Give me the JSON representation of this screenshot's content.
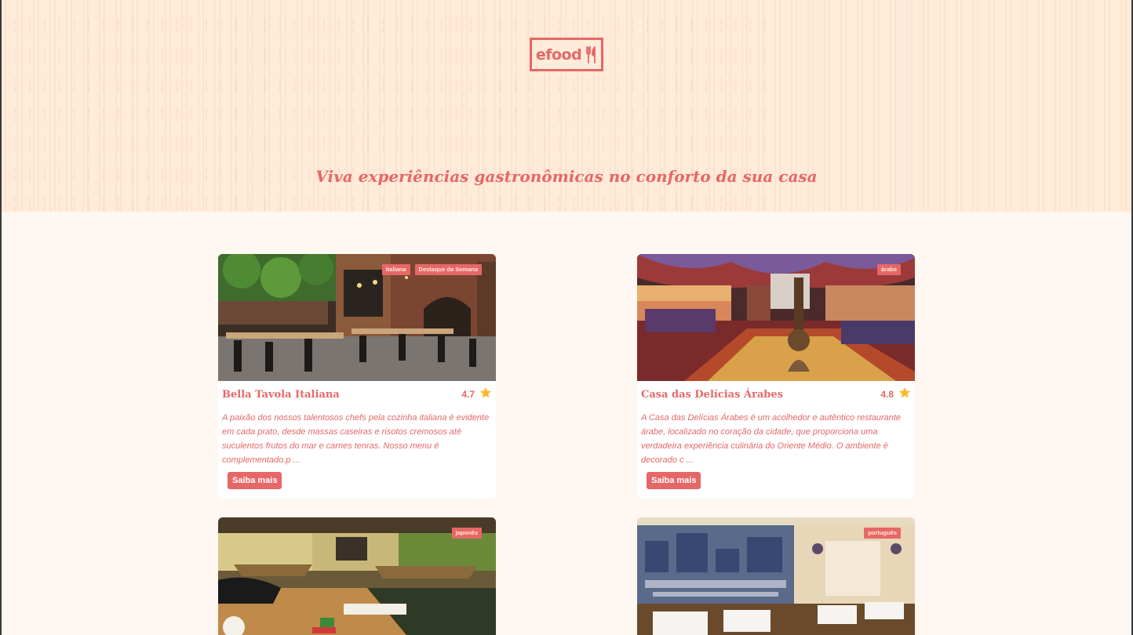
{
  "header": {
    "logo_text": "efood",
    "tagline": "Viva experiências gastronômicas no conforto da sua casa"
  },
  "colors": {
    "primary": "#e66767",
    "hero_bg": "#ffebd9",
    "page_bg": "#fff8f2",
    "star": "#ffb930"
  },
  "restaurants": [
    {
      "name": "Bella Tavola Italiana",
      "rating": "4.7",
      "tags": [
        "italiana",
        "Destaque da Semana"
      ],
      "description": "A paixão dos nossos talentosos chefs pela cozinha italiana é evidente em cada prato, desde massas caseiras e risotos cremosos até suculentos frutos do mar e carnes tenras. Nosso menu é complementado.p ...",
      "button": "Saiba mais"
    },
    {
      "name": "Casa das Delícias Árabes",
      "rating": "4.8",
      "tags": [
        "árabe"
      ],
      "description": "A Casa das Delícias Árabes é um acolhedor e autêntico restaurante árabe, localizado no coração da cidade, que proporciona uma verdadeira experiência culinária do Oriente Médio. O ambiente é decorado c ...",
      "button": "Saiba mais"
    },
    {
      "tags": [
        "japonês"
      ]
    },
    {
      "tags": [
        "português"
      ]
    }
  ]
}
